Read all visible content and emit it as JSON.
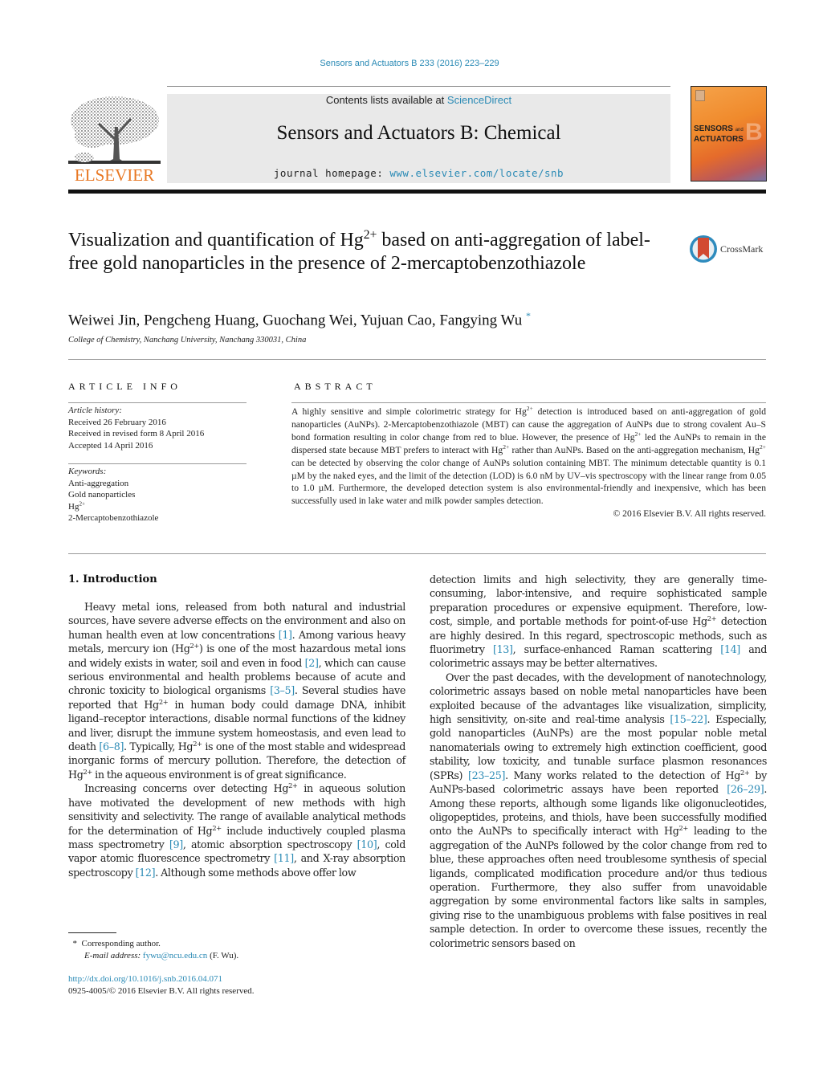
{
  "header": {
    "citation": "Sensors and Actuators B 233 (2016) 223–229",
    "contents_prefix": "Contents lists available at ",
    "contents_link": "ScienceDirect",
    "journal_title": "Sensors and Actuators B: Chemical",
    "homepage_prefix": "journal homepage: ",
    "homepage_link": "www.elsevier.com/locate/snb",
    "publisher_logo": "ELSEVIER",
    "cover_title_line1": "SENSORS",
    "cover_title_and": "and",
    "cover_title_line2": "ACTUATORS",
    "cover_letter": "B",
    "crossmark_label": "CrossMark"
  },
  "article": {
    "title_part1": "Visualization and quantification of Hg",
    "title_sup": "2+",
    "title_part2": " based on anti-aggregation of label-free gold nanoparticles in the presence of 2-mercaptobenzothiazole",
    "authors": "Weiwei Jin, Pengcheng Huang, Guochang Wei, Yujuan Cao, Fangying Wu",
    "author_mark": "*",
    "affiliation": "College of Chemistry, Nanchang University, Nanchang 330031, China"
  },
  "article_info": {
    "heading": "ARTICLE INFO",
    "history_label": "Article history:",
    "history": [
      "Received 26 February 2016",
      "Received in revised form 8 April 2016",
      "Accepted 14 April 2016"
    ],
    "keywords_label": "Keywords:",
    "keywords": [
      "Anti-aggregation",
      "Gold nanoparticles",
      "Hg",
      "2-Mercaptobenzothiazole"
    ],
    "keyword_sup": "2+"
  },
  "abstract": {
    "heading": "ABSTRACT",
    "s1a": "A highly sensitive and simple colorimetric strategy for Hg",
    "s1b": " detection is introduced based on anti-aggregation of gold nanoparticles (AuNPs). 2-Mercaptobenzothiazole (MBT) can cause the aggregation of AuNPs due to strong covalent Au–S bond formation resulting in color change from red to blue. However, the presence of Hg",
    "s1c": " led the AuNPs to remain in the dispersed state because MBT prefers to interact with Hg",
    "s1d": " rather than AuNPs. Based on the anti-aggregation mechanism, Hg",
    "s1e": " can be detected by observing the color change of AuNPs solution containing MBT. The minimum detectable quantity is 0.1 µM by the naked eyes, and the limit of the detection (LOD) is 6.0 nM by UV–vis spectroscopy with the linear range from 0.05 to 1.0 µM. Furthermore, the developed detection system is also environmental-friendly and inexpensive, which has been successfully used in lake water and milk powder samples detection.",
    "sup": "2+",
    "copyright": "© 2016 Elsevier B.V. All rights reserved."
  },
  "body": {
    "section_heading": "1.  Introduction",
    "sup": "2+",
    "left": {
      "p1a": "Heavy metal ions, released from both natural and industrial sources, have severe adverse effects on the environment and also on human health even at low concentrations ",
      "ref1": "[1]",
      "p1b": ". Among various heavy metals, mercury ion (Hg",
      "p1c": ") is one of the most hazardous metal ions and widely exists in water, soil and even in food ",
      "ref2": "[2]",
      "p1d": ", which can cause serious environmental and health problems because of acute and chronic toxicity to biological organisms ",
      "ref3": "[3–5]",
      "p1e": ". Several studies have reported that Hg",
      "p1f": " in human body could damage DNA, inhibit ligand–receptor interactions, disable normal functions of the kidney and liver, disrupt the immune system homeostasis, and even lead to death ",
      "ref4": "[6–8]",
      "p1g": ". Typically, Hg",
      "p1h": " is one of the most stable and widespread inorganic forms of mercury pollution. Therefore, the detection of Hg",
      "p1i": " in the aqueous environment is of great significance.",
      "p2a": "Increasing concerns over detecting Hg",
      "p2b": " in aqueous solution have motivated the development of new methods with high sensitivity and selectivity. The range of available analytical methods for the determination of Hg",
      "p2c": " include inductively coupled plasma mass spectrometry ",
      "ref5": "[9]",
      "p2d": ", atomic absorption spectroscopy ",
      "ref6": "[10]",
      "p2e": ", cold vapor atomic fluorescence spectrometry ",
      "ref7": "[11]",
      "p2f": ", and X-ray absorption spectroscopy ",
      "ref8": "[12]",
      "p2g": ". Although some methods above offer low"
    },
    "right": {
      "p1a": "detection limits and high selectivity, they are generally time-consuming, labor-intensive, and require sophisticated sample preparation procedures or expensive equipment. Therefore, low-cost, simple, and portable methods for point-of-use Hg",
      "p1b": " detection are highly desired. In this regard, spectroscopic methods, such as fluorimetry ",
      "ref1": "[13]",
      "p1c": ", surface-enhanced Raman scattering ",
      "ref2": "[14]",
      "p1d": " and colorimetric assays may be better alternatives.",
      "p2a": "Over the past decades, with the development of nanotechnology, colorimetric assays based on noble metal nanoparticles have been exploited because of the advantages like visualization, simplicity, high sensitivity, on-site and real-time analysis ",
      "ref3": "[15–22]",
      "p2b": ". Especially, gold nanoparticles (AuNPs) are the most popular noble metal nanomaterials owing to extremely high extinction coefficient, good stability, low toxicity, and tunable surface plasmon resonances (SPRs) ",
      "ref4": "[23–25]",
      "p2c": ". Many works related to the detection of Hg",
      "p2d": " by AuNPs-based colorimetric assays have been reported ",
      "ref5": "[26–29]",
      "p2e": ". Among these reports, although some ligands like oligonucleotides, oligopeptides, proteins, and thiols, have been successfully modified onto the AuNPs to specifically interact with Hg",
      "p2f": " leading to the aggregation of the AuNPs followed by the color change from red to blue, these approaches often need troublesome synthesis of special ligands, complicated modification procedure and/or thus tedious operation. Furthermore, they also suffer from unavoidable aggregation by some environmental factors like salts in samples, giving rise to the unambiguous problems with false positives in real sample detection. In order to overcome these issues, recently the colorimetric sensors based on"
    }
  },
  "footnote": {
    "mark": "*",
    "corresponding": "Corresponding author.",
    "email_label": "E-mail address: ",
    "email": "fywu@ncu.edu.cn",
    "email_suffix": " (F. Wu).",
    "doi": "http://dx.doi.org/10.1016/j.snb.2016.04.071",
    "issn": "0925-4005/© 2016 Elsevier B.V. All rights reserved."
  }
}
